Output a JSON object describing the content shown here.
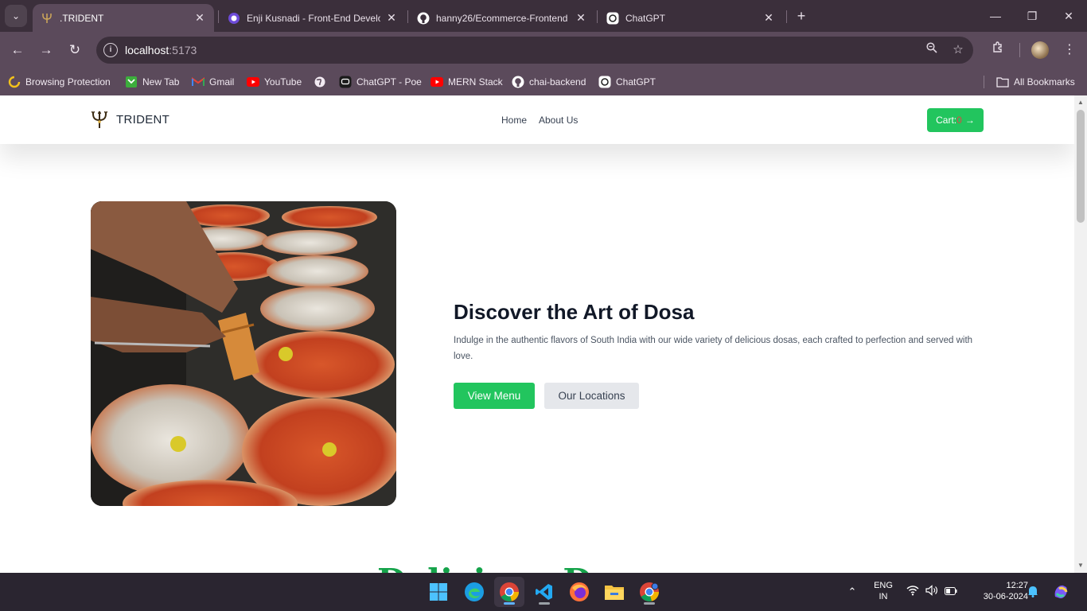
{
  "browser": {
    "tabs": [
      {
        "title": ".TRIDENT",
        "active": true
      },
      {
        "title": "Enji Kusnadi - Front-End Develo",
        "active": false
      },
      {
        "title": "hanny26/Ecommerce-Frontend",
        "active": false
      },
      {
        "title": "ChatGPT",
        "active": false
      }
    ],
    "address": {
      "host": "localhost",
      "port": ":5173"
    },
    "bookmarks": [
      {
        "label": "Browsing Protection"
      },
      {
        "label": "New Tab"
      },
      {
        "label": "Gmail"
      },
      {
        "label": "YouTube"
      },
      {
        "label": "ChatGPT - Poe"
      },
      {
        "label": "MERN Stack"
      },
      {
        "label": "chai-backend"
      },
      {
        "label": "ChatGPT"
      }
    ],
    "all_bookmarks_label": "All Bookmarks"
  },
  "site": {
    "brand": "TRIDENT",
    "nav": [
      {
        "label": "Home"
      },
      {
        "label": "About Us"
      }
    ],
    "cart": {
      "label": "Cart:",
      "count": "0",
      "arrow": "→"
    }
  },
  "hero": {
    "title": "Discover the Art of Dosa",
    "text": "Indulge in the authentic flavors of South India with our wide variety of delicious dosas, each crafted to perfection and served with love.",
    "primary_button": "View Menu",
    "secondary_button": "Our Locations"
  },
  "next_section": {
    "heading": "Delicious Dosa"
  },
  "taskbar": {
    "lang_top": "ENG",
    "lang_bottom": "IN",
    "time": "12:27",
    "date": "30-06-2024"
  },
  "colors": {
    "chrome_dark": "#3b2f3b",
    "chrome_mid": "#5b4a5b",
    "accent_green": "#22c55e",
    "heading_green": "#15a34a",
    "taskbar": "#2a2530"
  }
}
